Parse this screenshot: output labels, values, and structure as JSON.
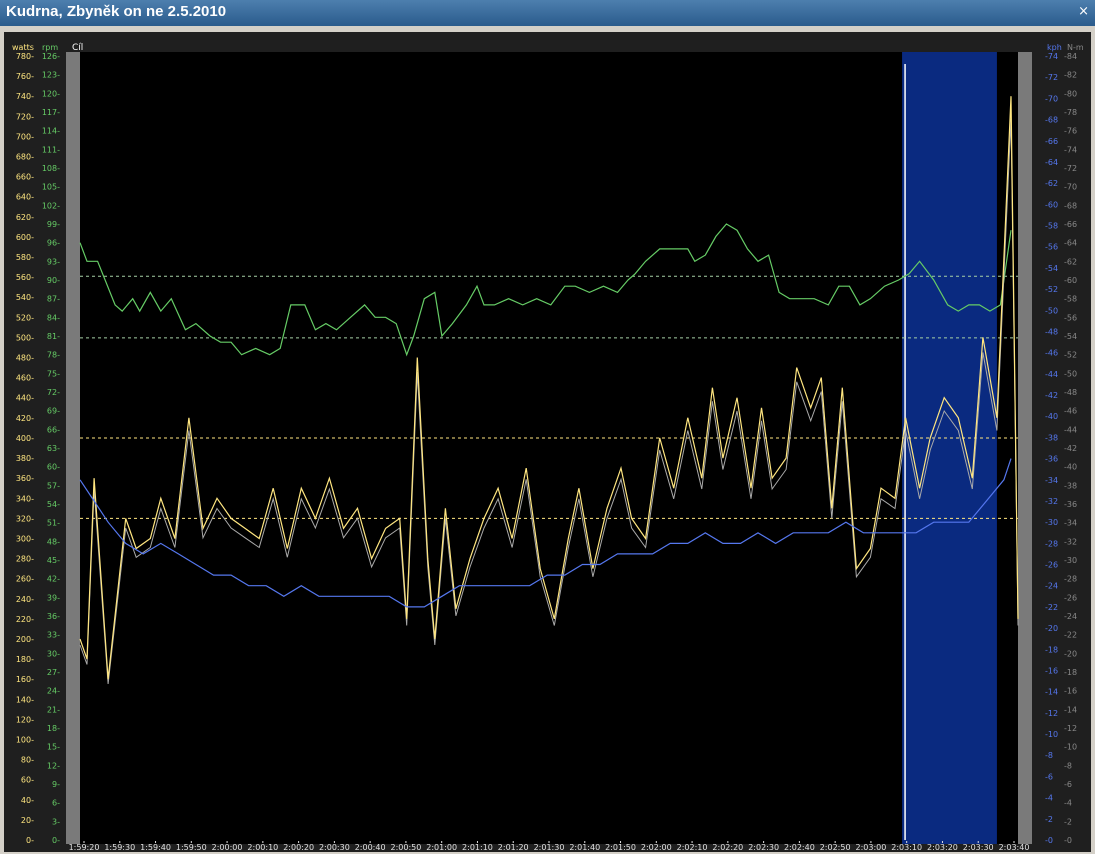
{
  "window": {
    "title": "Kudrna, Zbyněk on ne 2.5.2010",
    "close_label": "×"
  },
  "marker_label": "Cíl",
  "colors": {
    "power": "#ffe680",
    "power_raw": "#aaaaaa",
    "cadence": "#66cc66",
    "speed": "#5577ee",
    "torque": "#888888",
    "selection": "#0a2a80",
    "bg": "#000000"
  },
  "chart_data": {
    "type": "line",
    "x_ticks": [
      "1:59:20",
      "1:59:30",
      "1:59:40",
      "1:59:50",
      "2:00:00",
      "2:00:10",
      "2:00:20",
      "2:00:30",
      "2:00:40",
      "2:00:50",
      "2:01:00",
      "2:01:10",
      "2:01:20",
      "2:01:30",
      "2:01:40",
      "2:01:50",
      "2:02:00",
      "2:02:10",
      "2:02:20",
      "2:02:30",
      "2:02:40",
      "2:02:50",
      "2:03:00",
      "2:03:10",
      "2:03:20",
      "2:03:30",
      "2:03:40"
    ],
    "x_start_seconds": 7155,
    "x_end_seconds": 7422,
    "selection": {
      "from": "2:03:09",
      "to": "2:03:36"
    },
    "axes": {
      "watts": {
        "label": "watts",
        "range": [
          0,
          780
        ],
        "step": 20
      },
      "rpm": {
        "label": "rpm",
        "range": [
          0,
          126
        ],
        "step": 3
      },
      "kph": {
        "label": "kph",
        "range": [
          0,
          74
        ],
        "step": 2
      },
      "nm": {
        "label": "N-m",
        "range": [
          0,
          84
        ],
        "step": 2
      }
    },
    "reference_lines": [
      {
        "axis": "rpm",
        "value": 90.6,
        "color": "#a6d0a6"
      },
      {
        "axis": "rpm",
        "value": 80.7,
        "color": "#a6d0a6"
      },
      {
        "axis": "watts",
        "value": 400,
        "color": "#ffe680"
      },
      {
        "axis": "watts",
        "value": 320,
        "color": "#ffe680"
      }
    ],
    "series": [
      {
        "name": "rpm",
        "axis": "rpm",
        "values": [
          [
            7155,
            96
          ],
          [
            7157,
            93
          ],
          [
            7160,
            93
          ],
          [
            7165,
            86
          ],
          [
            7167,
            85
          ],
          [
            7170,
            87
          ],
          [
            7172,
            85
          ],
          [
            7175,
            88
          ],
          [
            7178,
            85
          ],
          [
            7181,
            87
          ],
          [
            7185,
            82
          ],
          [
            7188,
            83
          ],
          [
            7192,
            81
          ],
          [
            7195,
            80
          ],
          [
            7198,
            80
          ],
          [
            7201,
            78
          ],
          [
            7205,
            79
          ],
          [
            7209,
            78
          ],
          [
            7212,
            79
          ],
          [
            7215,
            86
          ],
          [
            7219,
            86
          ],
          [
            7222,
            82
          ],
          [
            7225,
            83
          ],
          [
            7228,
            82
          ],
          [
            7232,
            84
          ],
          [
            7236,
            86
          ],
          [
            7239,
            84
          ],
          [
            7242,
            84
          ],
          [
            7245,
            83
          ],
          [
            7248,
            78
          ],
          [
            7250,
            81
          ],
          [
            7253,
            87
          ],
          [
            7256,
            88
          ],
          [
            7258,
            81
          ],
          [
            7261,
            83
          ],
          [
            7265,
            86
          ],
          [
            7268,
            89
          ],
          [
            7270,
            86
          ],
          [
            7273,
            86
          ],
          [
            7277,
            87
          ],
          [
            7281,
            86
          ],
          [
            7285,
            87
          ],
          [
            7289,
            86
          ],
          [
            7293,
            89
          ],
          [
            7296,
            89
          ],
          [
            7300,
            88
          ],
          [
            7304,
            89
          ],
          [
            7308,
            88
          ],
          [
            7311,
            90
          ],
          [
            7313,
            91
          ],
          [
            7316,
            93
          ],
          [
            7320,
            95
          ],
          [
            7325,
            95
          ],
          [
            7328,
            95
          ],
          [
            7330,
            93
          ],
          [
            7333,
            94
          ],
          [
            7336,
            97
          ],
          [
            7339,
            99
          ],
          [
            7342,
            98
          ],
          [
            7345,
            95
          ],
          [
            7348,
            93
          ],
          [
            7351,
            94
          ],
          [
            7354,
            88
          ],
          [
            7357,
            87
          ],
          [
            7360,
            87
          ],
          [
            7364,
            87
          ],
          [
            7368,
            86
          ],
          [
            7371,
            89
          ],
          [
            7374,
            89
          ],
          [
            7377,
            86
          ],
          [
            7380,
            87
          ],
          [
            7384,
            89
          ],
          [
            7388,
            90
          ],
          [
            7391,
            91
          ],
          [
            7394,
            93
          ],
          [
            7398,
            90
          ],
          [
            7402,
            86
          ],
          [
            7405,
            85
          ],
          [
            7408,
            86
          ],
          [
            7411,
            86
          ],
          [
            7414,
            85
          ],
          [
            7417,
            86
          ],
          [
            7420,
            98
          ]
        ]
      },
      {
        "name": "watts",
        "axis": "watts",
        "values": [
          [
            7155,
            200
          ],
          [
            7157,
            180
          ],
          [
            7159,
            360
          ],
          [
            7163,
            160
          ],
          [
            7168,
            320
          ],
          [
            7171,
            290
          ],
          [
            7175,
            300
          ],
          [
            7178,
            340
          ],
          [
            7182,
            300
          ],
          [
            7186,
            420
          ],
          [
            7190,
            310
          ],
          [
            7194,
            340
          ],
          [
            7198,
            320
          ],
          [
            7202,
            310
          ],
          [
            7206,
            300
          ],
          [
            7210,
            350
          ],
          [
            7214,
            290
          ],
          [
            7218,
            350
          ],
          [
            7222,
            320
          ],
          [
            7226,
            360
          ],
          [
            7230,
            310
          ],
          [
            7234,
            330
          ],
          [
            7238,
            280
          ],
          [
            7242,
            310
          ],
          [
            7246,
            320
          ],
          [
            7248,
            220
          ],
          [
            7251,
            480
          ],
          [
            7254,
            280
          ],
          [
            7256,
            200
          ],
          [
            7259,
            330
          ],
          [
            7262,
            230
          ],
          [
            7266,
            280
          ],
          [
            7270,
            320
          ],
          [
            7274,
            350
          ],
          [
            7278,
            300
          ],
          [
            7282,
            370
          ],
          [
            7286,
            270
          ],
          [
            7290,
            220
          ],
          [
            7294,
            300
          ],
          [
            7297,
            350
          ],
          [
            7301,
            270
          ],
          [
            7305,
            330
          ],
          [
            7309,
            370
          ],
          [
            7312,
            320
          ],
          [
            7316,
            300
          ],
          [
            7320,
            400
          ],
          [
            7324,
            350
          ],
          [
            7328,
            420
          ],
          [
            7332,
            360
          ],
          [
            7335,
            450
          ],
          [
            7338,
            380
          ],
          [
            7342,
            440
          ],
          [
            7346,
            350
          ],
          [
            7349,
            430
          ],
          [
            7352,
            360
          ],
          [
            7356,
            380
          ],
          [
            7359,
            470
          ],
          [
            7363,
            430
          ],
          [
            7366,
            460
          ],
          [
            7369,
            330
          ],
          [
            7372,
            450
          ],
          [
            7376,
            270
          ],
          [
            7380,
            290
          ],
          [
            7383,
            350
          ],
          [
            7387,
            340
          ],
          [
            7390,
            420
          ],
          [
            7394,
            350
          ],
          [
            7397,
            400
          ],
          [
            7401,
            440
          ],
          [
            7405,
            420
          ],
          [
            7409,
            360
          ],
          [
            7412,
            500
          ],
          [
            7416,
            420
          ],
          [
            7420,
            740
          ],
          [
            7422,
            220
          ]
        ]
      },
      {
        "name": "kph",
        "axis": "kph",
        "values": [
          [
            7155,
            34
          ],
          [
            7159,
            32
          ],
          [
            7163,
            30
          ],
          [
            7168,
            28
          ],
          [
            7173,
            27
          ],
          [
            7178,
            28
          ],
          [
            7183,
            27
          ],
          [
            7188,
            26
          ],
          [
            7193,
            25
          ],
          [
            7198,
            25
          ],
          [
            7203,
            24
          ],
          [
            7208,
            24
          ],
          [
            7213,
            23
          ],
          [
            7218,
            24
          ],
          [
            7223,
            23
          ],
          [
            7228,
            23
          ],
          [
            7233,
            23
          ],
          [
            7238,
            23
          ],
          [
            7243,
            23
          ],
          [
            7248,
            22
          ],
          [
            7253,
            22
          ],
          [
            7258,
            23
          ],
          [
            7263,
            24
          ],
          [
            7268,
            24
          ],
          [
            7273,
            24
          ],
          [
            7278,
            24
          ],
          [
            7283,
            24
          ],
          [
            7288,
            25
          ],
          [
            7293,
            25
          ],
          [
            7298,
            26
          ],
          [
            7303,
            26
          ],
          [
            7308,
            27
          ],
          [
            7313,
            27
          ],
          [
            7318,
            27
          ],
          [
            7323,
            28
          ],
          [
            7328,
            28
          ],
          [
            7333,
            29
          ],
          [
            7338,
            28
          ],
          [
            7343,
            28
          ],
          [
            7348,
            29
          ],
          [
            7353,
            28
          ],
          [
            7358,
            29
          ],
          [
            7363,
            29
          ],
          [
            7368,
            29
          ],
          [
            7373,
            30
          ],
          [
            7378,
            29
          ],
          [
            7383,
            29
          ],
          [
            7388,
            29
          ],
          [
            7393,
            29
          ],
          [
            7398,
            30
          ],
          [
            7403,
            30
          ],
          [
            7408,
            30
          ],
          [
            7413,
            32
          ],
          [
            7418,
            34
          ],
          [
            7420,
            36
          ]
        ]
      }
    ]
  }
}
